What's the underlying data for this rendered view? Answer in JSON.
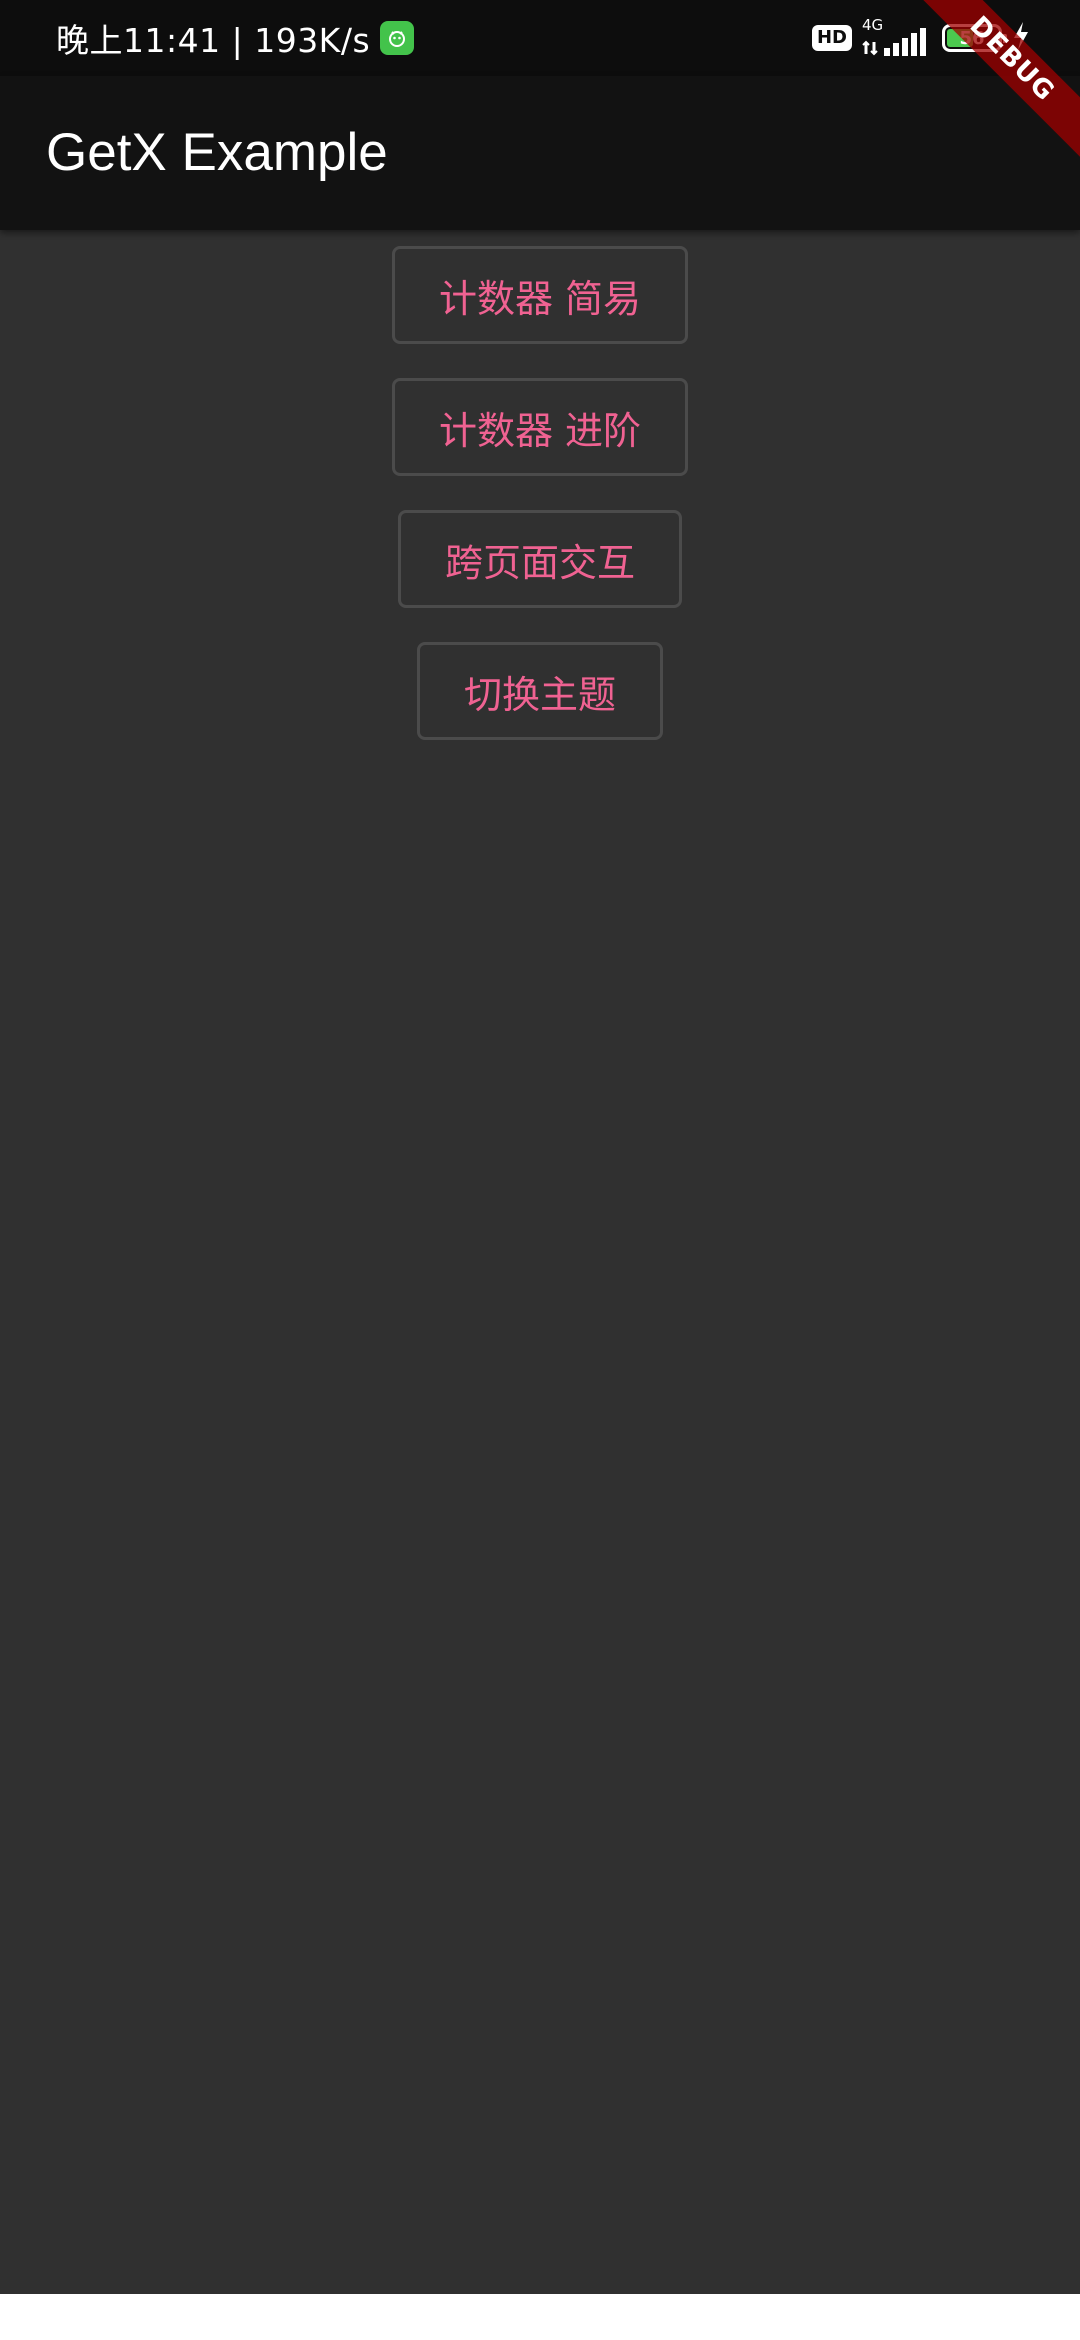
{
  "status_bar": {
    "time_speed": "晚上11:41 | 193K/s",
    "hd_label": "HD",
    "network_label": "4G",
    "battery_level": "56",
    "battery_fraction": 0.56,
    "icons": [
      "app-notification-icon",
      "signal-icon",
      "battery-icon",
      "charging-icon"
    ]
  },
  "app_bar": {
    "title": "GetX Example"
  },
  "buttons": [
    {
      "label": "计数器 简易"
    },
    {
      "label": "计数器 进阶"
    },
    {
      "label": "跨页面交互"
    },
    {
      "label": "切换主题"
    }
  ],
  "debug_banner": {
    "label": "DEBUG"
  },
  "colors": {
    "background": "#303030",
    "app_bar": "#121212",
    "accent": "#f06292",
    "button_border": "#4b4b4b"
  }
}
